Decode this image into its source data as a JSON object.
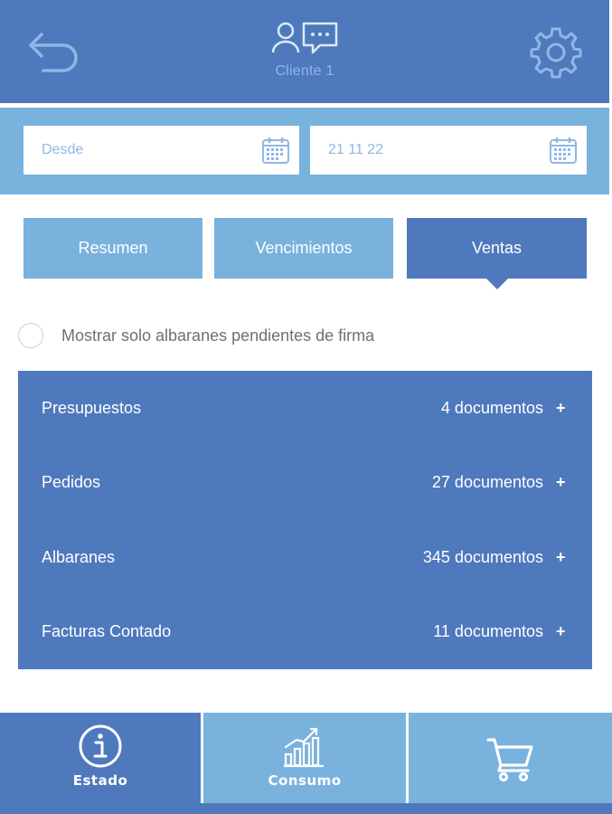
{
  "header": {
    "client_name": "Cliente 1",
    "icons": {
      "back": "back-arrow-icon",
      "client": "client-chat-icon",
      "settings": "gear-icon"
    }
  },
  "dates": {
    "from": {
      "value": "",
      "placeholder": "Desde"
    },
    "to": {
      "value": "21 11 22",
      "placeholder": ""
    }
  },
  "tabs": [
    {
      "label": "Resumen",
      "active": false
    },
    {
      "label": "Vencimientos",
      "active": false
    },
    {
      "label": "Ventas",
      "active": true
    }
  ],
  "filter": {
    "label": "Mostrar solo albaranes pendientes de firma",
    "checked": false
  },
  "documents": [
    {
      "name": "Presupuestos",
      "count": "4 documentos",
      "action": "+"
    },
    {
      "name": "Pedidos",
      "count": "27 documentos",
      "action": "+"
    },
    {
      "name": "Albaranes",
      "count": "345 documentos",
      "action": "+"
    },
    {
      "name": "Facturas Contado",
      "count": "11 documentos",
      "action": "+"
    }
  ],
  "bottom_nav": [
    {
      "label": "Estado",
      "icon": "info-icon",
      "active": true
    },
    {
      "label": "Consumo",
      "icon": "chart-icon",
      "active": false
    },
    {
      "label": "",
      "icon": "cart-icon",
      "active": false
    }
  ],
  "colors": {
    "primary": "#4f79bd",
    "secondary": "#79b2dd",
    "light_text": "#8fb7e6"
  }
}
